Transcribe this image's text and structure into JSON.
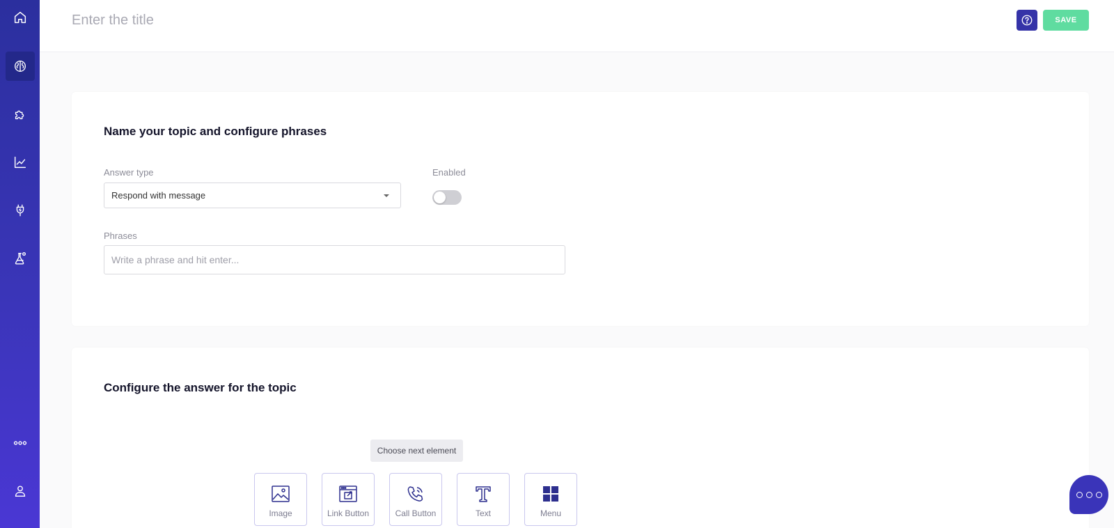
{
  "sidebar": {
    "items": [
      {
        "icon": "home-icon"
      },
      {
        "icon": "brain-icon"
      },
      {
        "icon": "puzzle-icon"
      },
      {
        "icon": "chart-line-icon"
      },
      {
        "icon": "plug-icon"
      },
      {
        "icon": "flask-icon"
      },
      {
        "icon": "more-icon"
      },
      {
        "icon": "user-icon"
      }
    ],
    "active": "brain-icon"
  },
  "header": {
    "title_placeholder": "Enter the title",
    "title_value": "",
    "help_icon": "help-circle-icon",
    "save_label": "SAVE"
  },
  "topic_card": {
    "title": "Name your topic and configure phrases",
    "answer_type_label": "Answer type",
    "answer_type_value": "Respond with message",
    "enabled_label": "Enabled",
    "enabled": false,
    "phrases_label": "Phrases",
    "phrases_placeholder": "Write a phrase and hit enter..."
  },
  "answer_card": {
    "title": "Configure the answer for the topic",
    "choose_next": "Choose next element",
    "elements": [
      {
        "label": "Image",
        "icon": "image-icon"
      },
      {
        "label": "Link Button",
        "icon": "link-button-icon"
      },
      {
        "label": "Call Button",
        "icon": "phone-icon"
      },
      {
        "label": "Text",
        "icon": "text-icon"
      },
      {
        "label": "Menu",
        "icon": "grid-icon"
      }
    ]
  },
  "colors": {
    "sidebar_top": "#2b2f9e",
    "sidebar_bottom": "#4a37d4",
    "save_button": "#5fdca0",
    "help_button": "#3533a8",
    "accent": "#3a34b9"
  }
}
